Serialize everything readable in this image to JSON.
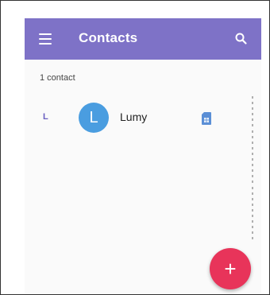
{
  "app_bar": {
    "title": "Contacts",
    "menu_icon": "menu-icon",
    "search_icon": "search-icon",
    "color": "#7e72c7"
  },
  "contacts": {
    "count_label": "1 contact",
    "items": [
      {
        "section_letter": "L",
        "avatar_initial": "L",
        "avatar_color": "#4a9de0",
        "name": "Lumy",
        "account_icon": "sim-card-icon"
      }
    ]
  },
  "fab": {
    "label": "+",
    "icon": "add-icon",
    "color": "#e8345a"
  }
}
